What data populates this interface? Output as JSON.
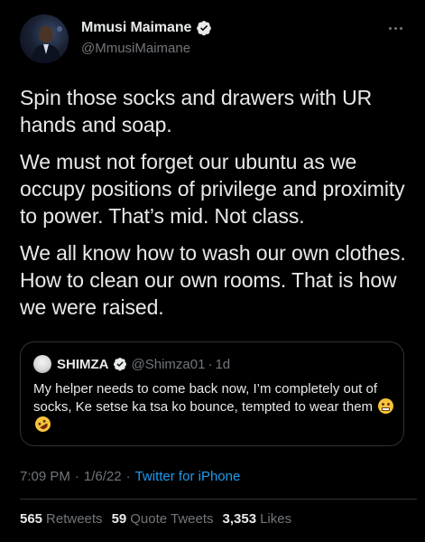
{
  "author": {
    "display_name": "Mmusi Maimane",
    "handle": "@MmusiMaimane",
    "verified": true
  },
  "tweet": {
    "paragraphs": [
      "Spin those socks and drawers with UR hands and soap.",
      "We must not forget our ubuntu as we occupy positions of privilege and proximity to power. That’s mid. Not class.",
      "We all know how to wash our own clothes. How to clean our own rooms. That is how we were raised."
    ]
  },
  "quote": {
    "display_name": "SHIMZA",
    "handle": "@Shimza01",
    "separator": "·",
    "time": "1d",
    "text": "My helper needs to come back now, I’m completely out of socks, Ke setse ka tsa ko bounce, tempted to wear them",
    "emojis": [
      "grimacing-emoji",
      "rofl-emoji"
    ]
  },
  "meta": {
    "time": "7:09 PM",
    "separator": "·",
    "date": "1/6/22",
    "source": "Twitter for iPhone"
  },
  "stats": {
    "retweets_count": "565",
    "retweets_label": "Retweets",
    "quote_count": "59",
    "quote_label": "Quote Tweets",
    "likes_count": "3,353",
    "likes_label": "Likes"
  },
  "colors": {
    "background": "#000000",
    "text": "#e7e9ea",
    "secondary": "#71767b",
    "accent": "#1d9bf0",
    "border": "#2f3336"
  }
}
